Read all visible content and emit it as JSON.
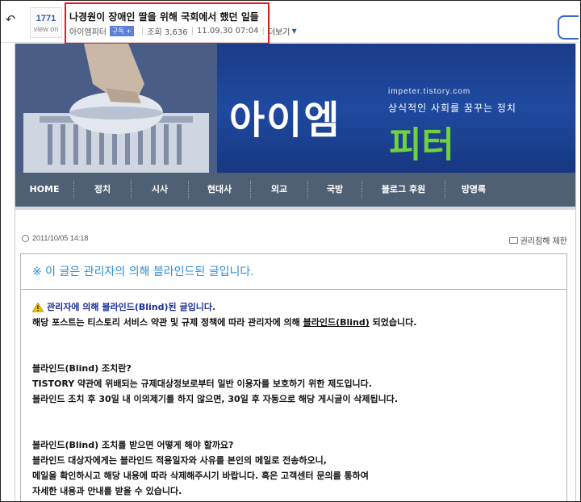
{
  "topbar": {
    "back_icon": "back-arrow-icon",
    "views_count": "1771",
    "views_label": "view on",
    "post_title": "나경원이 장애인 딸을 위해 국회에서 했던 일들",
    "author": "아이엠피터",
    "subscribe_label": "구독 +",
    "views_text": "조회 3,636",
    "datetime": "11.09.30 07:04",
    "more_label": "더보기"
  },
  "blog": {
    "url": "impeter.tistory.com",
    "title_main": "아이엠",
    "title_accent": "피터",
    "slogan": "상식적인 사회를 꿈꾸는 정치",
    "nav": [
      "HOME",
      "정치",
      "시사",
      "현대사",
      "외교",
      "국방",
      "블로그 후원",
      "방명록"
    ],
    "post_date": "2011/10/05 14:18",
    "report_label": "권리침해 제한"
  },
  "notice": {
    "heading": "※ 이 글은 관리자의 의해 블라인드된 글입니다.",
    "warn_title": "관리자에 의해 블라인드(Blind)된 글입니다.",
    "line1_pre": "해당 포스트는 티스토리 서비스 약관 및 규제 정책에 따라 관리자에 의해 ",
    "line1_link": "블라인드(Blind)",
    "line1_post": " 되었습니다.",
    "q1": "블라인드(Blind) 조치란?",
    "a1_1": "TISTORY 약관에 위배되는 규제대상정보로부터 일반 이용자를 보호하기 위한 제도입니다.",
    "a1_2": "블라인드 조치 후 30일 내 이의제기를 하지 않으면, 30일 후 자동으로 해당 게시글이 삭제됩니다.",
    "q2": "블라인드(Blind) 조치를 받으면 어떻게 해야 할까요?",
    "a2_1": "블라인드 대상자에게는 블라인드 적용일자와 사유를 본인의 메일로 전송하오니,",
    "a2_2": "메일을 확인하시고 해당 내용에 따라 삭제해주시기 바랍니다. 혹은 고객센터 문의를 통하여",
    "a2_3": "자세한 내용과 안내를 받을 수 있습니다."
  },
  "colors": {
    "highlight_box": "#e41b1b",
    "header_bg": "#1f4aa0",
    "title_accent": "#6fd13c",
    "nav_bg": "#4f5f74",
    "notice_heading": "#2a8dd8"
  }
}
